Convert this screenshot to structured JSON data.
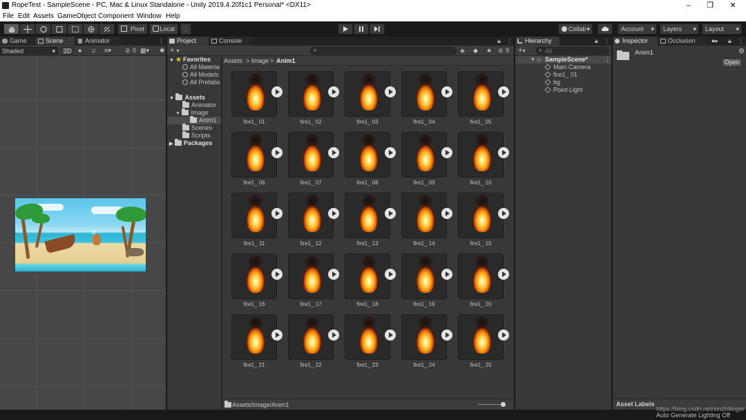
{
  "window": {
    "title": "RopeTest - SampleScene - PC, Mac & Linux Standalone - Unity 2019.4.20f1c1 Personal* <DX11>"
  },
  "menu": [
    "File",
    "Edit",
    "Assets",
    "GameObject",
    "Component",
    "Window",
    "Help"
  ],
  "toolbar": {
    "pivot": "Pivot",
    "local": "Local",
    "collab": "Collab",
    "account": "Account",
    "layers": "Layers",
    "layout": "Layout"
  },
  "scene_panel": {
    "tabs": [
      "Game",
      "Scene",
      "Animator"
    ],
    "shading": "Shaded",
    "mode_2d": "2D",
    "hidden_count": "0"
  },
  "project_panel": {
    "tabs": [
      "Project",
      "Console"
    ],
    "add_label": "+",
    "search_placeholder": "",
    "hidden_count": "9",
    "breadcrumb": [
      "Assets",
      "Image",
      "Anim1"
    ],
    "favorites_label": "Favorites",
    "favorites": [
      "All Materia",
      "All Models",
      "All Prefabs"
    ],
    "assets_label": "Assets",
    "tree": [
      "Animator",
      "Image",
      "Anim1",
      "Scenes",
      "Scripts"
    ],
    "packages_label": "Packages",
    "assets": [
      "fire1_ 01",
      "fire1_ 02",
      "fire1_ 03",
      "fire1_ 04",
      "fire1_ 05",
      "fire1_ 06",
      "fire1_ 07",
      "fire1_ 08",
      "fire1_ 09",
      "fire1_ 10",
      "fire1_ 11",
      "fire1_ 12",
      "fire1_ 13",
      "fire1_ 14",
      "fire1_ 15",
      "fire1_ 16",
      "fire1_ 17",
      "fire1_ 18",
      "fire1_ 19",
      "fire1_ 20",
      "fire1_ 21",
      "fire1_ 22",
      "fire1_ 23",
      "fire1_ 24",
      "fire1_ 25"
    ],
    "footer_path": "Assets/Image/Anim1"
  },
  "hierarchy_panel": {
    "tab": "Hierarchy",
    "search_placeholder": "All",
    "scene": "SampleScene*",
    "items": [
      "Main Camera",
      "fire1_ 01",
      "bg",
      "Point Light"
    ]
  },
  "inspector_panel": {
    "tabs": [
      "Inspector",
      "Occlusion"
    ],
    "object_name": "Anim1",
    "open_button": "Open",
    "asset_labels": "Asset Labels"
  },
  "status": {
    "watermark": "https://blog.csdn.net/xinzhilinger",
    "lighting": "Auto Generate Lighting Off"
  }
}
